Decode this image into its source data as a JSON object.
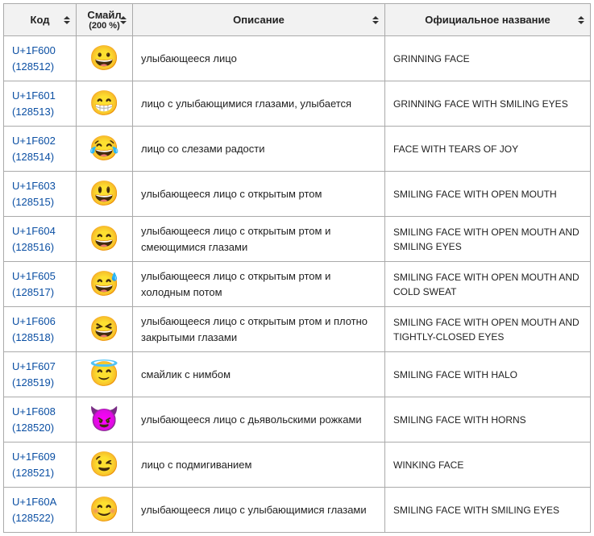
{
  "headers": {
    "code": "Код",
    "emoji_main": "Смайл",
    "emoji_sub": "(200 %)",
    "desc": "Описание",
    "name": "Официальное название"
  },
  "rows": [
    {
      "unicode": "U+1F600",
      "dec": "(128512)",
      "emoji": "😀",
      "desc": "улыбающееся лицо",
      "name": "GRINNING FACE"
    },
    {
      "unicode": "U+1F601",
      "dec": "(128513)",
      "emoji": "😁",
      "desc": "лицо с улыбающимися глазами, улыбается",
      "name": "GRINNING FACE WITH SMILING EYES"
    },
    {
      "unicode": "U+1F602",
      "dec": "(128514)",
      "emoji": "😂",
      "desc": "лицо со слезами радости",
      "name": "FACE WITH TEARS OF JOY"
    },
    {
      "unicode": "U+1F603",
      "dec": "(128515)",
      "emoji": "😃",
      "desc": "улыбающееся лицо с открытым ртом",
      "name": "SMILING FACE WITH OPEN MOUTH"
    },
    {
      "unicode": "U+1F604",
      "dec": "(128516)",
      "emoji": "😄",
      "desc": "улыбающееся лицо с открытым ртом и смеющимися глазами",
      "name": "SMILING FACE WITH OPEN MOUTH AND SMILING EYES"
    },
    {
      "unicode": "U+1F605",
      "dec": "(128517)",
      "emoji": "😅",
      "desc": "улыбающееся лицо с открытым ртом и холодным потом",
      "name": "SMILING FACE WITH OPEN MOUTH AND COLD SWEAT"
    },
    {
      "unicode": "U+1F606",
      "dec": "(128518)",
      "emoji": "😆",
      "desc": "улыбающееся лицо с открытым ртом и плотно закрытыми глазами",
      "name": "SMILING FACE WITH OPEN MOUTH AND TIGHTLY-CLOSED EYES"
    },
    {
      "unicode": "U+1F607",
      "dec": "(128519)",
      "emoji": "😇",
      "desc": "смайлик с нимбом",
      "name": "SMILING FACE WITH HALO"
    },
    {
      "unicode": "U+1F608",
      "dec": "(128520)",
      "emoji": "😈",
      "desc": "улыбающееся лицо с дьявольскими рожками",
      "name": "SMILING FACE WITH HORNS"
    },
    {
      "unicode": "U+1F609",
      "dec": "(128521)",
      "emoji": "😉",
      "desc": "лицо с подмигиванием",
      "name": "WINKING FACE"
    },
    {
      "unicode": "U+1F60A",
      "dec": "(128522)",
      "emoji": "😊",
      "desc": "улыбающееся лицо с улыбающимися глазами",
      "name": "SMILING FACE WITH SMILING EYES"
    }
  ]
}
